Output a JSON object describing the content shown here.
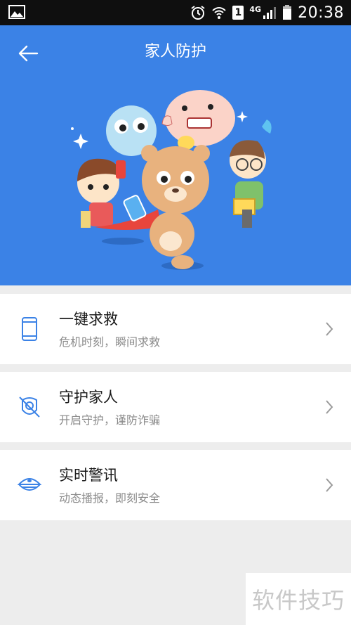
{
  "status_bar": {
    "time": "20:38",
    "sim": "1",
    "network": "4G"
  },
  "header": {
    "title": "家人防护"
  },
  "items": [
    {
      "label": "一键求救",
      "sub": "危机时刻，瞬间求救",
      "icon": "phone-icon"
    },
    {
      "label": "守护家人",
      "sub": "开启守护，谨防诈骗",
      "icon": "shield-guard-icon"
    },
    {
      "label": "实时警讯",
      "sub": "动态播报，即刻安全",
      "icon": "police-cap-icon"
    }
  ],
  "watermark": "软件技巧",
  "colors": {
    "hero": "#3b82e6",
    "icon": "#3b82e6",
    "background": "#ededed"
  }
}
